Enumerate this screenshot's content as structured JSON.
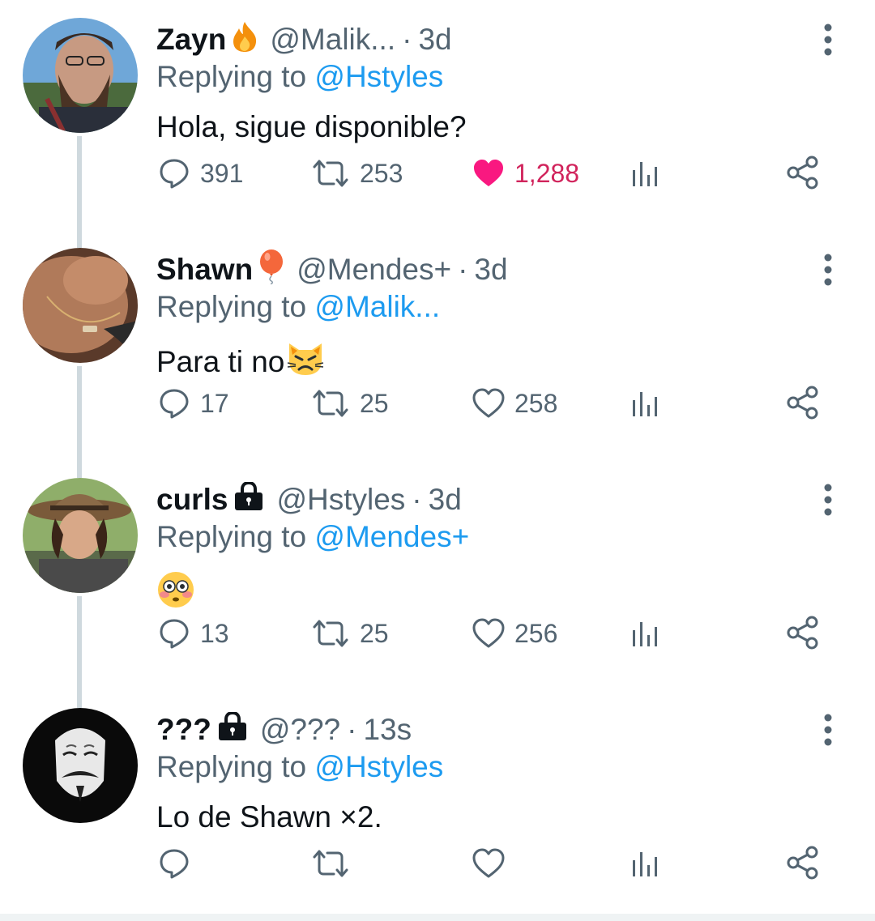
{
  "colors": {
    "accent": "#1d9bf0",
    "liked": "#d1245c",
    "muted": "#536471",
    "text": "#0f1419"
  },
  "tweets": [
    {
      "name": "Zayn",
      "badge": "fire-emoji",
      "handle": "@Malik...",
      "time": "3d",
      "replying_label": "Replying to",
      "replying_to": "@Hstyles",
      "text": "Hola, sigue disponible?",
      "emoji": "",
      "replies": "391",
      "retweets": "253",
      "likes": "1,288",
      "liked": true
    },
    {
      "name": "Shawn",
      "badge": "balloon-emoji",
      "handle": "@Mendes+",
      "time": "3d",
      "replying_label": "Replying to",
      "replying_to": "@Malik...",
      "text": "Para ti no",
      "emoji": "pouting-cat-emoji",
      "replies": "17",
      "retweets": "25",
      "likes": "258",
      "liked": false
    },
    {
      "name": "curls",
      "badge": "lock-icon",
      "handle": "@Hstyles",
      "time": "3d",
      "replying_label": "Replying to",
      "replying_to": "@Mendes+",
      "text": "",
      "emoji": "flushed-face-emoji",
      "replies": "13",
      "retweets": "25",
      "likes": "256",
      "liked": false
    },
    {
      "name": "???",
      "badge": "lock-icon",
      "handle": "@???",
      "time": "13s",
      "replying_label": "Replying to",
      "replying_to": "@Hstyles",
      "text": "Lo de Shawn ×2.",
      "emoji": "",
      "replies": "",
      "retweets": "",
      "likes": "",
      "liked": false
    }
  ]
}
